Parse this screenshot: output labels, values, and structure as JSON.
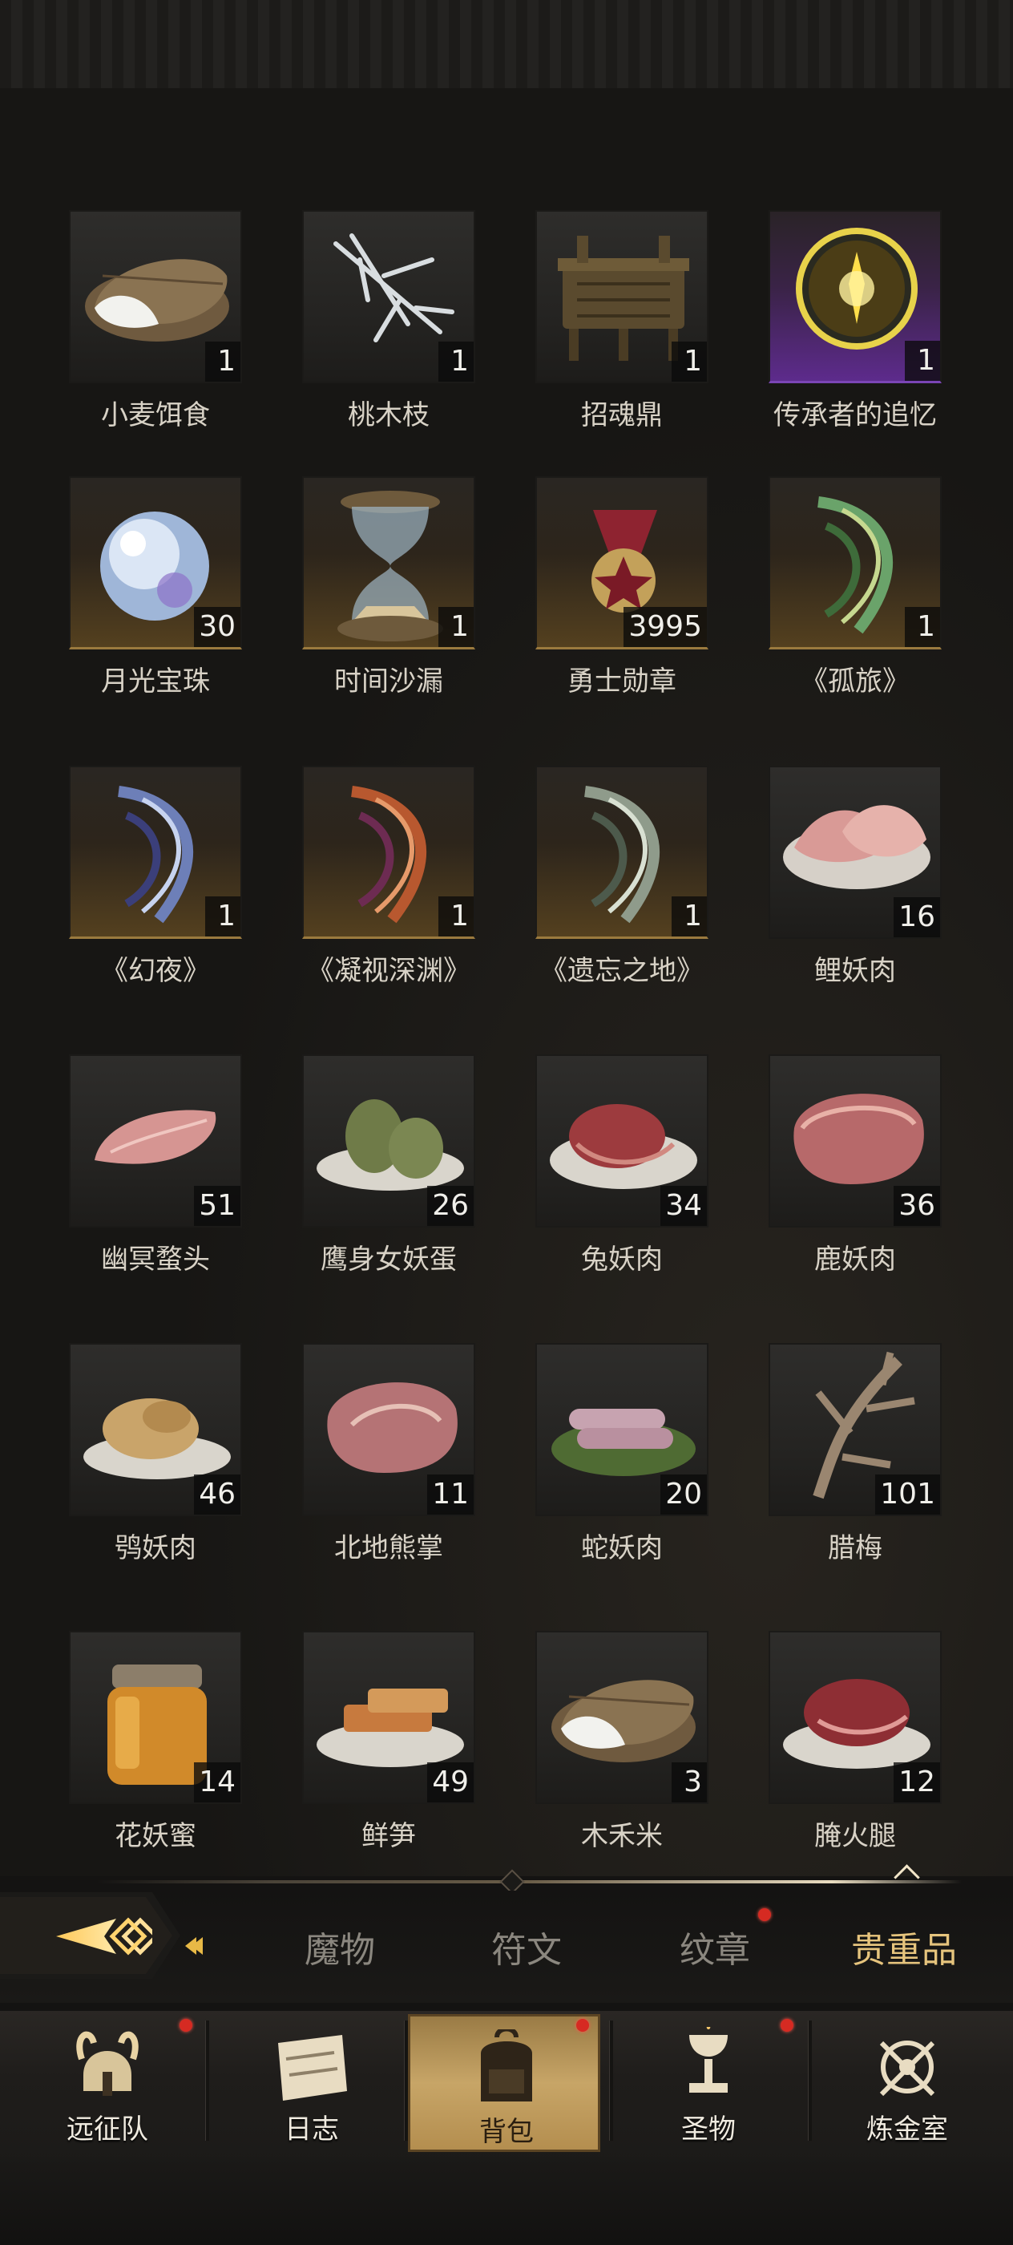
{
  "items": [
    {
      "name": "小麦饵食",
      "count": "1",
      "tile": "plain",
      "icon": "rice-sack-icon"
    },
    {
      "name": "桃木枝",
      "count": "1",
      "tile": "plain",
      "icon": "branches-icon"
    },
    {
      "name": "招魂鼎",
      "count": "1",
      "tile": "plain",
      "icon": "cauldron-icon"
    },
    {
      "name": "传承者的追忆",
      "count": "1",
      "tile": "purple",
      "icon": "golden-orb-icon"
    },
    {
      "name": "月光宝珠",
      "count": "30",
      "tile": "gold",
      "icon": "pearl-icon"
    },
    {
      "name": "时间沙漏",
      "count": "1",
      "tile": "gold",
      "icon": "hourglass-icon"
    },
    {
      "name": "勇士勋章",
      "count": "3995",
      "tile": "gold",
      "icon": "medal-icon"
    },
    {
      "name": "《孤旅》",
      "count": "1",
      "tile": "gold",
      "icon": "green-scroll-icon"
    },
    {
      "name": "《幻夜》",
      "count": "1",
      "tile": "gold",
      "icon": "blue-scroll-icon"
    },
    {
      "name": "《凝视深渊》",
      "count": "1",
      "tile": "gold",
      "icon": "red-scroll-icon"
    },
    {
      "name": "《遗忘之地》",
      "count": "1",
      "tile": "gold",
      "icon": "grey-scroll-icon"
    },
    {
      "name": "鲤妖肉",
      "count": "16",
      "tile": "plain",
      "icon": "fish-meat-icon"
    },
    {
      "name": "幽冥蝥头",
      "count": "51",
      "tile": "plain",
      "icon": "raw-fillet-icon"
    },
    {
      "name": "鹰身女妖蛋",
      "count": "26",
      "tile": "plain",
      "icon": "eggs-icon"
    },
    {
      "name": "兔妖肉",
      "count": "34",
      "tile": "plain",
      "icon": "ham-slices-icon"
    },
    {
      "name": "鹿妖肉",
      "count": "36",
      "tile": "plain",
      "icon": "steak-icon"
    },
    {
      "name": "鸮妖肉",
      "count": "46",
      "tile": "plain",
      "icon": "bread-icon"
    },
    {
      "name": "北地熊掌",
      "count": "11",
      "tile": "plain",
      "icon": "bear-steak-icon"
    },
    {
      "name": "蛇妖肉",
      "count": "20",
      "tile": "plain",
      "icon": "sausages-icon"
    },
    {
      "name": "腊梅",
      "count": "101",
      "tile": "plain",
      "icon": "dry-branch-icon"
    },
    {
      "name": "花妖蜜",
      "count": "14",
      "tile": "plain",
      "icon": "honey-jar-icon"
    },
    {
      "name": "鲜笋",
      "count": "49",
      "tile": "plain",
      "icon": "bamboo-shoot-icon"
    },
    {
      "name": "木禾米",
      "count": "3",
      "tile": "plain",
      "icon": "rice-sack-icon"
    },
    {
      "name": "腌火腿",
      "count": "12",
      "tile": "plain",
      "icon": "cured-ham-icon"
    }
  ],
  "tabs": [
    {
      "label": "魔物",
      "active": false,
      "badge": false
    },
    {
      "label": "符文",
      "active": false,
      "badge": false
    },
    {
      "label": "纹章",
      "active": false,
      "badge": true
    },
    {
      "label": "贵重品",
      "active": true,
      "badge": false
    }
  ],
  "nav": [
    {
      "label": "远征队",
      "icon": "viking-helmet-icon",
      "active": false,
      "badge": true
    },
    {
      "label": "日志",
      "icon": "scroll-map-icon",
      "active": false,
      "badge": false
    },
    {
      "label": "背包",
      "icon": "backpack-icon",
      "active": true,
      "badge": true
    },
    {
      "label": "圣物",
      "icon": "chalice-icon",
      "active": false,
      "badge": true
    },
    {
      "label": "炼金室",
      "icon": "alchemy-icon",
      "active": false,
      "badge": false
    }
  ],
  "colors": {
    "accent": "#e6c47d",
    "badge": "#d62a22",
    "gold_tile": "#9b7a3e",
    "purple_tile": "#5d2b8c"
  }
}
